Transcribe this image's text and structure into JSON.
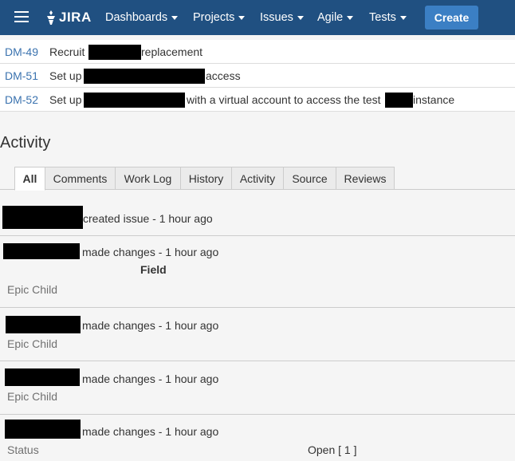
{
  "header": {
    "logo_text": "JIRA",
    "nav": [
      {
        "label": "Dashboards"
      },
      {
        "label": "Projects"
      },
      {
        "label": "Issues"
      },
      {
        "label": "Agile"
      },
      {
        "label": "Tests"
      }
    ],
    "create_label": "Create"
  },
  "issues": [
    {
      "key": "DM-49",
      "prefix": "Recruit",
      "suffix": "replacement"
    },
    {
      "key": "DM-51",
      "prefix": "Set up",
      "suffix": "access"
    },
    {
      "key": "DM-52",
      "prefix": "Set up",
      "middle": "with a virtual account to access the test",
      "suffix": "instance"
    }
  ],
  "activity": {
    "heading": "Activity",
    "tabs": [
      "All",
      "Comments",
      "Work Log",
      "History",
      "Activity",
      "Source",
      "Reviews"
    ],
    "active_tab": "All",
    "entries": [
      {
        "action": "created issue - 1 hour ago"
      },
      {
        "action": "made changes - 1 hour ago",
        "field_header": "Field",
        "field": "Epic Child"
      },
      {
        "action": "made changes - 1 hour ago",
        "field": "Epic Child"
      },
      {
        "action": "made changes - 1 hour ago",
        "field": "Epic Child"
      },
      {
        "action": "made changes - 1 hour ago",
        "field": "Status",
        "value": "Open [ 1 ]"
      }
    ]
  }
}
